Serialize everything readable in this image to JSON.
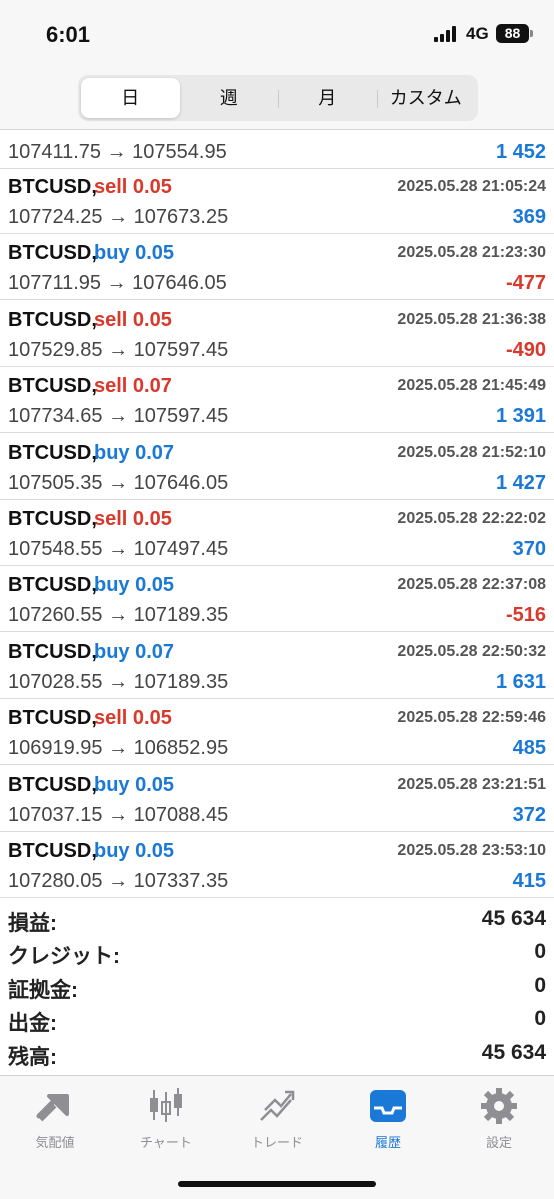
{
  "status": {
    "time": "6:01",
    "network": "4G",
    "battery": "88"
  },
  "tabs": [
    {
      "label": "日",
      "active": true
    },
    {
      "label": "週",
      "active": false
    },
    {
      "label": "月",
      "active": false
    },
    {
      "label": "カスタム",
      "active": false
    }
  ],
  "partial_row": {
    "prices": "107411.75 → 107554.95",
    "profit": "1 452"
  },
  "deals": [
    {
      "symbol": "BTCUSD,",
      "side": "sell",
      "side_label": "sell 0.05",
      "time": "2025.05.28 21:05:24",
      "prices": "107724.25 → 107673.25",
      "profit": "369"
    },
    {
      "symbol": "BTCUSD,",
      "side": "buy",
      "side_label": "buy 0.05",
      "time": "2025.05.28 21:23:30",
      "prices": "107711.95 → 107646.05",
      "profit": "-477"
    },
    {
      "symbol": "BTCUSD,",
      "side": "sell",
      "side_label": "sell 0.05",
      "time": "2025.05.28 21:36:38",
      "prices": "107529.85 → 107597.45",
      "profit": "-490"
    },
    {
      "symbol": "BTCUSD,",
      "side": "sell",
      "side_label": "sell 0.07",
      "time": "2025.05.28 21:45:49",
      "prices": "107734.65 → 107597.45",
      "profit": "1 391"
    },
    {
      "symbol": "BTCUSD,",
      "side": "buy",
      "side_label": "buy 0.07",
      "time": "2025.05.28 21:52:10",
      "prices": "107505.35 → 107646.05",
      "profit": "1 427"
    },
    {
      "symbol": "BTCUSD,",
      "side": "sell",
      "side_label": "sell 0.05",
      "time": "2025.05.28 22:22:02",
      "prices": "107548.55 → 107497.45",
      "profit": "370"
    },
    {
      "symbol": "BTCUSD,",
      "side": "buy",
      "side_label": "buy 0.05",
      "time": "2025.05.28 22:37:08",
      "prices": "107260.55 → 107189.35",
      "profit": "-516"
    },
    {
      "symbol": "BTCUSD,",
      "side": "buy",
      "side_label": "buy 0.07",
      "time": "2025.05.28 22:50:32",
      "prices": "107028.55 → 107189.35",
      "profit": "1 631"
    },
    {
      "symbol": "BTCUSD,",
      "side": "sell",
      "side_label": "sell 0.05",
      "time": "2025.05.28 22:59:46",
      "prices": "106919.95 → 106852.95",
      "profit": "485"
    },
    {
      "symbol": "BTCUSD,",
      "side": "buy",
      "side_label": "buy 0.05",
      "time": "2025.05.28 23:21:51",
      "prices": "107037.15 → 107088.45",
      "profit": "372"
    },
    {
      "symbol": "BTCUSD,",
      "side": "buy",
      "side_label": "buy 0.05",
      "time": "2025.05.28 23:53:10",
      "prices": "107280.05 → 107337.35",
      "profit": "415"
    }
  ],
  "summary": [
    {
      "label": "損益:",
      "value": "45 634"
    },
    {
      "label": "クレジット:",
      "value": "0"
    },
    {
      "label": "証拠金:",
      "value": "0"
    },
    {
      "label": "出金:",
      "value": "0"
    },
    {
      "label": "残高:",
      "value": "45 634"
    }
  ],
  "tabbar": [
    {
      "label": "気配値",
      "icon": "quotes-icon",
      "active": false
    },
    {
      "label": "チャート",
      "icon": "candlestick-chart-icon",
      "active": false
    },
    {
      "label": "トレード",
      "icon": "trade-icon",
      "active": false
    },
    {
      "label": "履歴",
      "icon": "history-inbox-icon",
      "active": true
    },
    {
      "label": "設定",
      "icon": "gear-icon",
      "active": false
    }
  ],
  "colors": {
    "buy": "#1a78d6",
    "sell": "#d9382b",
    "active_tab": "#1a78d6",
    "inactive_tab": "#8e8e93"
  }
}
